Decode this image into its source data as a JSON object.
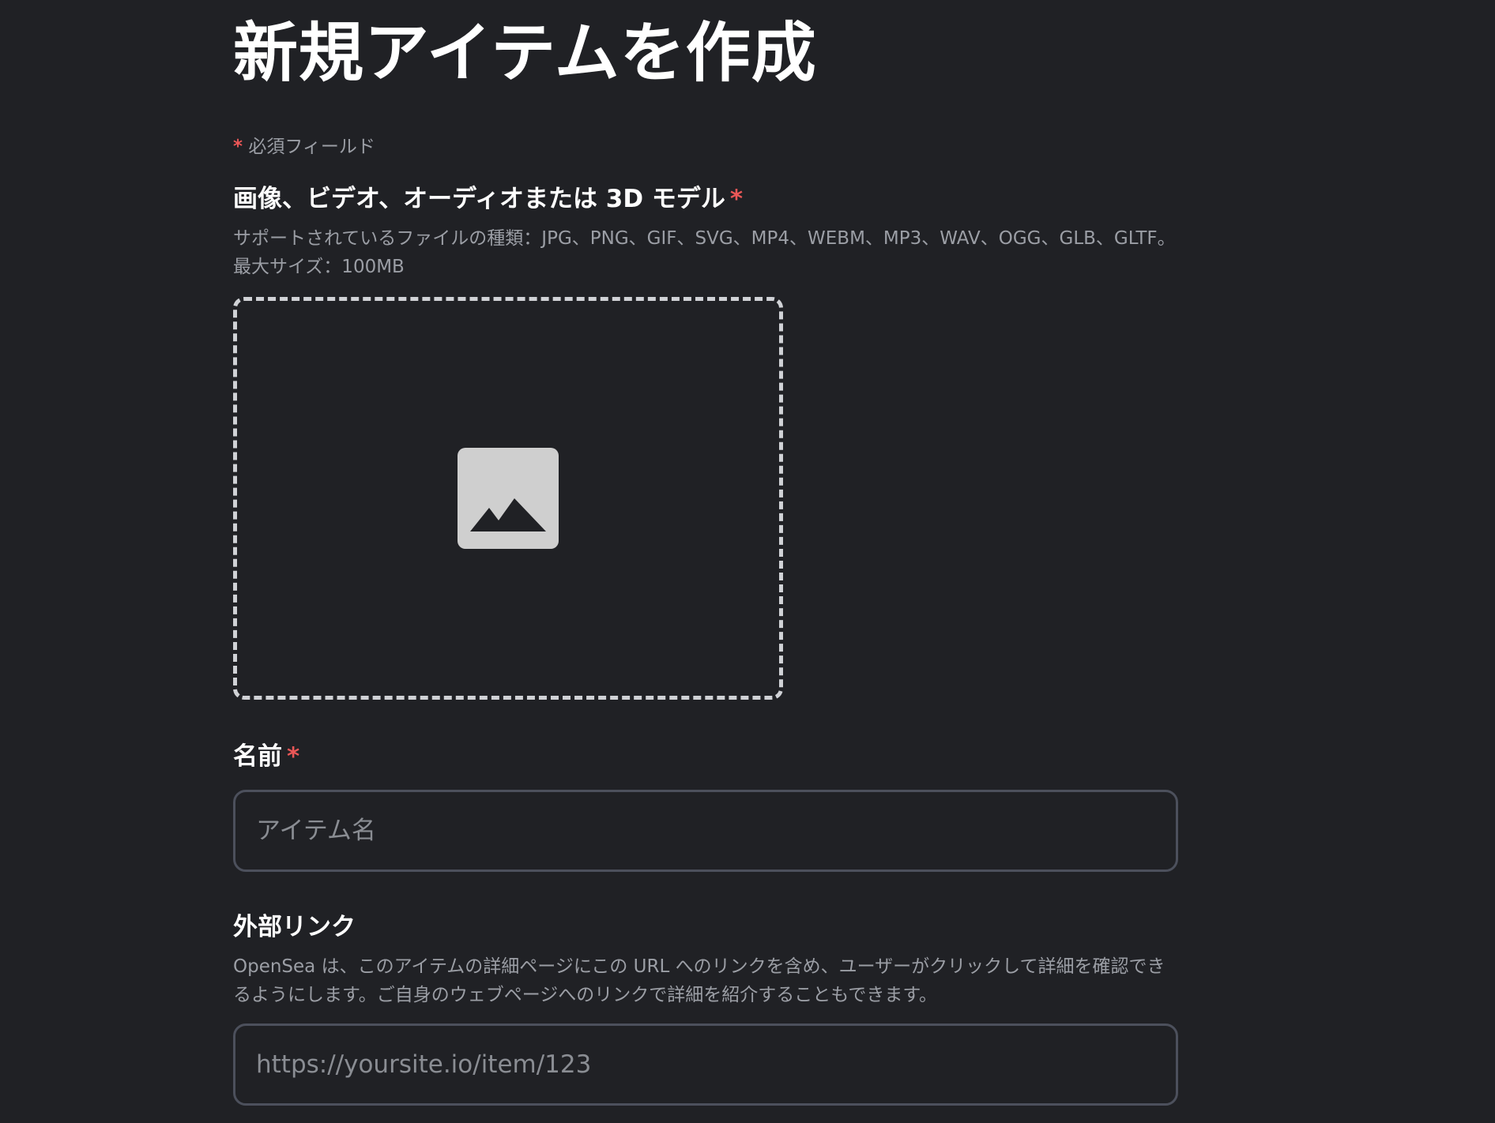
{
  "page": {
    "title": "新規アイテムを作成"
  },
  "required_note": {
    "asterisk": "*",
    "text": "必須フィールド"
  },
  "media_field": {
    "label": "画像、ビデオ、オーディオまたは 3D モデル",
    "required_mark": "*",
    "help": "サポートされているファイルの種類：JPG、PNG、GIF、SVG、MP4、WEBM、MP3、WAV、OGG、GLB、GLTF。最大サイズ：100MB",
    "dropzone_icon": "image-placeholder-icon"
  },
  "name_field": {
    "label": "名前",
    "required_mark": "*",
    "placeholder": "アイテム名",
    "value": ""
  },
  "external_link_field": {
    "label": "外部リンク",
    "help": "OpenSea は、このアイテムの詳細ページにこの URL へのリンクを含め、ユーザーがクリックして詳細を確認できるようにします。ご自身のウェブページへのリンクで詳細を紹介することもできます。",
    "placeholder": "https://yoursite.io/item/123",
    "value": ""
  },
  "colors": {
    "background": "#202125",
    "required_asterisk": "#eb5757",
    "field_border": "#4c505c",
    "dropzone_border": "#d0d2d6",
    "icon_fill": "#cfcfcf"
  }
}
